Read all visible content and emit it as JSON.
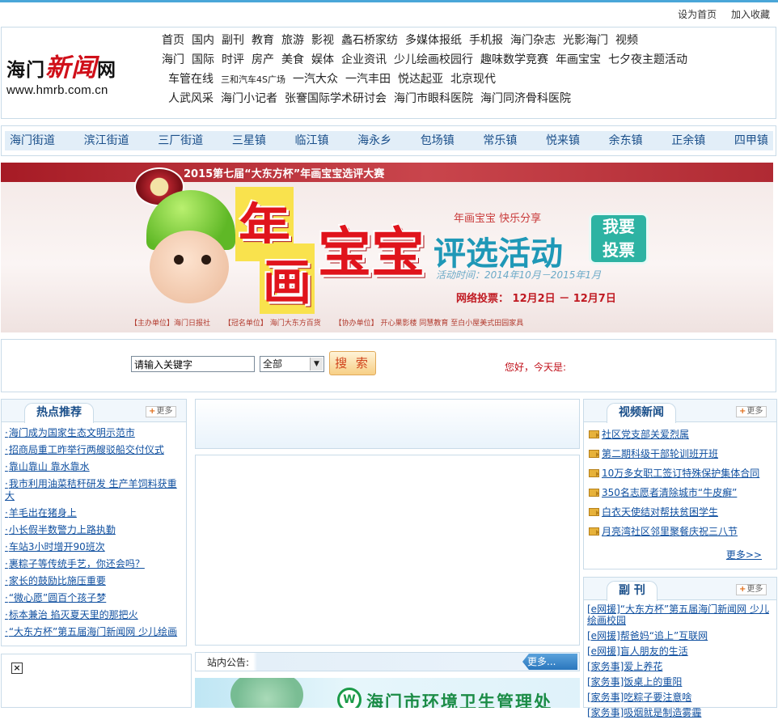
{
  "topbar": {
    "set_home": "设为首页",
    "add_fav": "加入收藏"
  },
  "logo": {
    "name_black_1": "海门",
    "name_red": "新闻",
    "name_black_2": "网",
    "url": "www.hmrb.com.cn"
  },
  "nav": {
    "row1": [
      "首页",
      "国内",
      "副刊",
      "教育",
      "旅游",
      "影视",
      "蠡石桥家纺",
      "多媒体报纸",
      "手机报",
      "海门杂志",
      "光影海门",
      "视频"
    ],
    "row2": [
      "海门",
      "国际",
      "时评",
      "房产",
      "美食",
      "娱体",
      "企业资讯",
      "少儿绘画校园行",
      "趣味数学竞赛",
      "年画宝宝",
      "七夕夜主题活动"
    ],
    "row3": [
      "车管在线",
      "三和汽车4S广场",
      "一汽大众",
      "一汽丰田",
      "悦达起亚",
      "北京现代"
    ],
    "row4": [
      "人武风采",
      "海门小记者",
      "张謇国际学术研讨会",
      "海门市眼科医院",
      "海门同济骨科医院"
    ]
  },
  "towns": [
    "海门街道",
    "滨江街道",
    "三厂街道",
    "三星镇",
    "临江镇",
    "海永乡",
    "包场镇",
    "常乐镇",
    "悦来镇",
    "余东镇",
    "正余镇",
    "四甲镇"
  ],
  "banner": {
    "contest": "2015第七届“大东方杯”年画宝宝选评大赛",
    "big1": "年",
    "big2": "画",
    "big3": "宝宝",
    "happy": "年画宝宝  快乐分享",
    "huodong": "评选活动",
    "vote1": "我要",
    "vote2": "投票",
    "time": "活动时间：2014年10月－2015年1月",
    "online": "网络投票：  12月2日 － 12月7日",
    "sponsor1": "【主办单位】海门日报社",
    "sponsor2": "【冠名单位】 海门大东方百货",
    "sponsor3": "【协办单位】 开心果影楼   同慧教育   至白小屋美式田园家具"
  },
  "search": {
    "placeholder": "请输入关键字",
    "value": "请输入关键字",
    "scope": "全部",
    "button": "搜 索",
    "greeting": "您好，今天是:"
  },
  "hot": {
    "title": "热点推荐",
    "more": "更多",
    "items": [
      "海门成为国家生态文明示范市",
      "招商局重工昨举行两艘驳船交付仪式",
      "靠山靠山 靠水靠水",
      "我市利用油菜秸秆研发 生产羊饲料获重大",
      "羊毛出在猪身上",
      "小长假半数警力上路执勤",
      "车站3小时增开90班次",
      "裹粽子等传统手艺，你还会吗？",
      "家长的鼓励比施压重要",
      "“微心愿”圆百个孩子梦",
      "标本兼治 掐灭夏天里的那把火",
      "“大东方杯”第五届海门新闻网 少儿绘画"
    ]
  },
  "video": {
    "title": "视频新闻",
    "more": "更多",
    "items": [
      "社区党支部关爱烈属",
      "第二期科级干部轮训班开班",
      "10万多女职工签订特殊保护集体合同",
      "350名志愿者清除城市“牛皮癣”",
      "白衣天使结对帮扶贫困学生",
      "月亮湾社区邻里聚餐庆祝三八节"
    ],
    "more_link": "更多>>"
  },
  "fukan": {
    "title": "副 刊",
    "more": "更多",
    "items": [
      "[e网援]“大东方杯”第五届海门新闻网 少儿绘画校园",
      "[e网援]帮爸妈“追上”互联网",
      "[e网援]盲人朋友的生活",
      "[家务事]爱上养花",
      "[家务事]饭桌上的重阳",
      "[家务事]吃粽子要注意啥",
      "[家务事]吸烟就是制造雾霾"
    ]
  },
  "notice": {
    "label": "站内公告:",
    "more": "更多..."
  },
  "env_banner": {
    "text": "海门市环境卫生管理处",
    "mark": "W"
  },
  "colors": {
    "accent": "#4aa6d8",
    "link": "#1050a0",
    "red": "#c0101a",
    "town_bg": "#e2eef8"
  }
}
